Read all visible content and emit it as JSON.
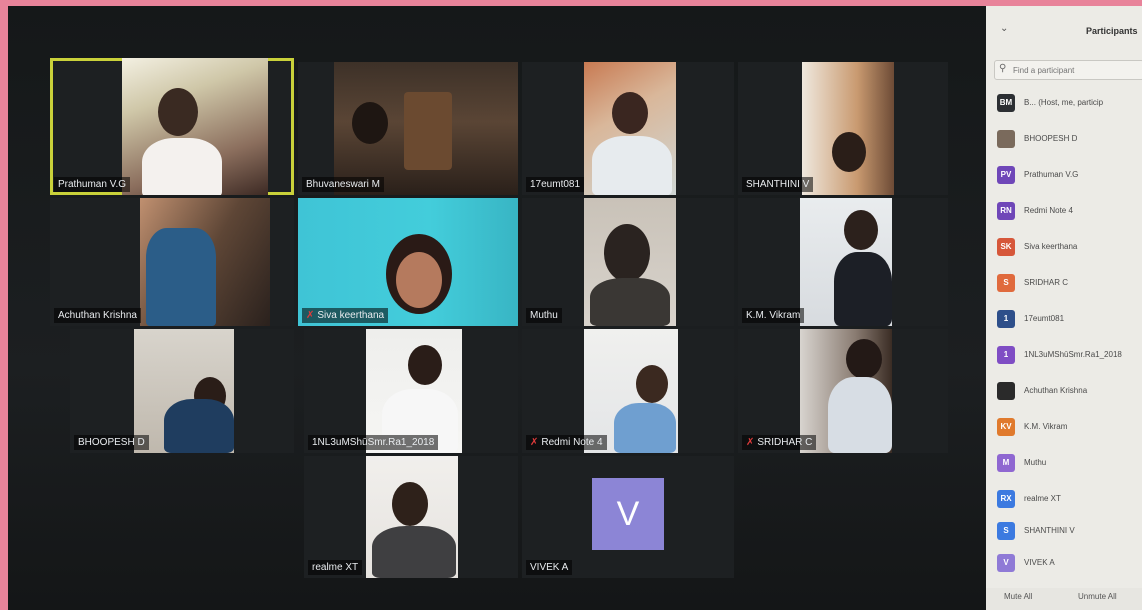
{
  "gallery": {
    "tiles": [
      {
        "name": "Prathuman V.G",
        "mic_muted": false,
        "active": true
      },
      {
        "name": "Bhuvaneswari M",
        "mic_muted": false
      },
      {
        "name": "17eumt081",
        "mic_muted": false
      },
      {
        "name": "SHANTHINI V",
        "mic_muted": false
      },
      {
        "name": "Achuthan Krishna",
        "mic_muted": false
      },
      {
        "name": "Siva keerthana",
        "mic_muted": true
      },
      {
        "name": "Muthu",
        "mic_muted": false
      },
      {
        "name": "K.M. Vikram",
        "mic_muted": false
      },
      {
        "name": "BHOOPESH D",
        "mic_muted": false
      },
      {
        "name": "1NL3uMShūSmr.Ra1_2018",
        "mic_muted": false
      },
      {
        "name": "Redmi Note 4",
        "mic_muted": true
      },
      {
        "name": "SRIDHAR C",
        "mic_muted": true
      },
      {
        "name": "realme XT",
        "mic_muted": false
      },
      {
        "name": "VIVEK A",
        "mic_muted": false,
        "avatar_letter": "V"
      }
    ]
  },
  "panel": {
    "title": "Participants",
    "collapse_icon": "chevron-down-icon",
    "search_placeholder": "Find a participant",
    "participants": [
      {
        "initials": "BM",
        "name": "B... (Host, me, particip",
        "color": "#2c2f33"
      },
      {
        "initials": "",
        "name": "BHOOPESH D",
        "color": "#7a6a5c"
      },
      {
        "initials": "PV",
        "name": "Prathuman V.G",
        "color": "#6f47b8"
      },
      {
        "initials": "RN",
        "name": "Redmi Note 4",
        "color": "#6f47b8"
      },
      {
        "initials": "SK",
        "name": "Siva keerthana",
        "color": "#d6573a"
      },
      {
        "initials": "S",
        "name": "SRIDHAR C",
        "color": "#e06a3d"
      },
      {
        "initials": "1",
        "name": "17eumt081",
        "color": "#2e4f8a"
      },
      {
        "initials": "1",
        "name": "1NL3uMShūSmr.Ra1_2018",
        "color": "#7f4dc4"
      },
      {
        "initials": "",
        "name": "Achuthan Krishna",
        "color": "#2a2a2a"
      },
      {
        "initials": "KV",
        "name": "K.M. Vikram",
        "color": "#e07a2d"
      },
      {
        "initials": "M",
        "name": "Muthu",
        "color": "#8f67d1"
      },
      {
        "initials": "RX",
        "name": "realme XT",
        "color": "#3c7ae0"
      },
      {
        "initials": "S",
        "name": "SHANTHINI V",
        "color": "#3c7ae0"
      },
      {
        "initials": "V",
        "name": "VIVEK A",
        "color": "#8f7ad6"
      }
    ],
    "mute_all": "Mute All",
    "unmute_all": "Unmute All"
  }
}
